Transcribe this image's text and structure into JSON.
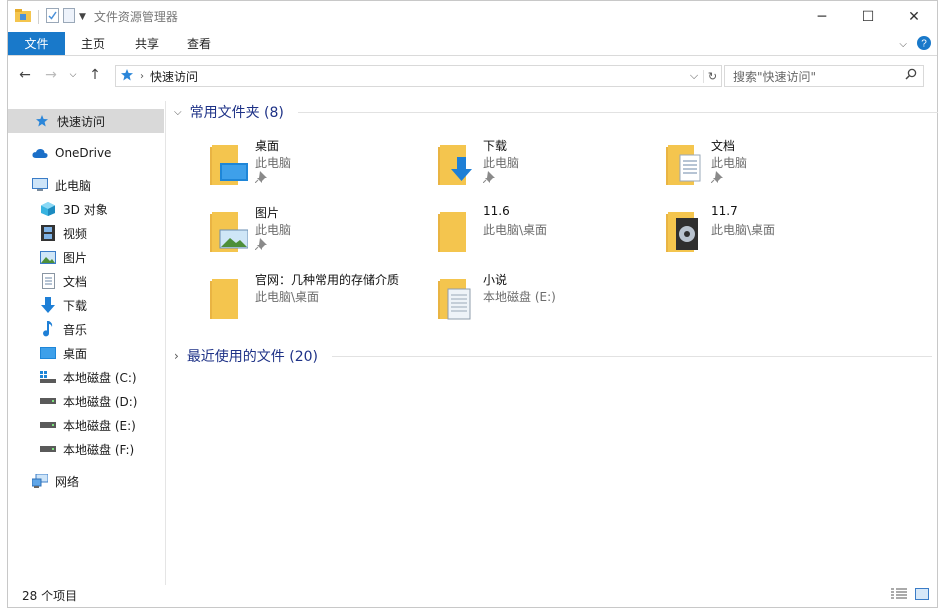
{
  "window": {
    "title": "文件资源管理器"
  },
  "ribbon": {
    "tabs": [
      "文件",
      "主页",
      "共享",
      "查看"
    ]
  },
  "address": {
    "location": "快速访问"
  },
  "search": {
    "placeholder": "搜索\"快速访问\""
  },
  "sidebar": {
    "items": [
      {
        "label": "快速访问",
        "icon": "star-pin-icon"
      },
      {
        "label": "OneDrive",
        "icon": "cloud-icon"
      },
      {
        "label": "此电脑",
        "icon": "computer-icon"
      },
      {
        "label": "3D 对象",
        "icon": "cube-3d-icon"
      },
      {
        "label": "视频",
        "icon": "film-icon"
      },
      {
        "label": "图片",
        "icon": "picture-icon"
      },
      {
        "label": "文档",
        "icon": "document-icon"
      },
      {
        "label": "下载",
        "icon": "download-arrow-icon"
      },
      {
        "label": "音乐",
        "icon": "music-note-icon"
      },
      {
        "label": "桌面",
        "icon": "desktop-icon"
      },
      {
        "label": "本地磁盘 (C:)",
        "icon": "drive-windows-icon"
      },
      {
        "label": "本地磁盘 (D:)",
        "icon": "drive-icon"
      },
      {
        "label": "本地磁盘 (E:)",
        "icon": "drive-icon"
      },
      {
        "label": "本地磁盘 (F:)",
        "icon": "drive-icon"
      },
      {
        "label": "网络",
        "icon": "network-icon"
      }
    ]
  },
  "groups": {
    "frequent": {
      "title": "常用文件夹 (8)"
    },
    "recent": {
      "title": "最近使用的文件 (20)"
    }
  },
  "folders": [
    {
      "name": "桌面",
      "location": "此电脑",
      "icon": "desktop-folder-icon"
    },
    {
      "name": "下载",
      "location": "此电脑",
      "icon": "downloads-folder-icon"
    },
    {
      "name": "文档",
      "location": "此电脑",
      "icon": "documents-folder-icon"
    },
    {
      "name": "图片",
      "location": "此电脑",
      "icon": "pictures-folder-icon"
    },
    {
      "name": "11.6",
      "location": "此电脑\\桌面",
      "icon": "folder-icon"
    },
    {
      "name": "11.7",
      "location": "此电脑\\桌面",
      "icon": "media-folder-icon"
    },
    {
      "name": "官网：几种常用的存储介质",
      "location": "此电脑\\桌面",
      "icon": "folder-icon"
    },
    {
      "name": "小说",
      "location": "本地磁盘 (E:)",
      "icon": "book-folder-icon"
    }
  ],
  "status": {
    "item_count": "28 个项目"
  },
  "colors": {
    "accent": "#1979ca",
    "group_heading": "#1e3287",
    "folder": "#f4c54e"
  }
}
